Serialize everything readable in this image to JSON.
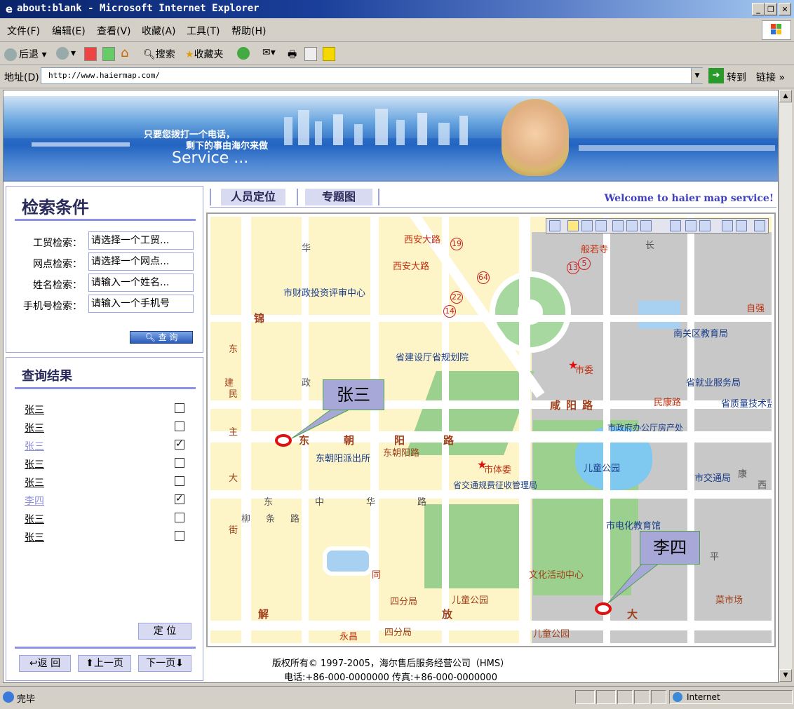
{
  "window": {
    "title": "about:blank - Microsoft Internet Explorer"
  },
  "menu": [
    "文件(F)",
    "编辑(E)",
    "查看(V)",
    "收藏(A)",
    "工具(T)",
    "帮助(H)"
  ],
  "toolbar": {
    "back": "后退",
    "search": "搜索",
    "favorites": "收藏夹"
  },
  "address": {
    "label": "地址(D)",
    "url": "http://www.haiermap.com/",
    "go": "转到",
    "links": "链接"
  },
  "banner": {
    "slogan1": "只要您拨打一个电话，",
    "slogan2": "剩下的事由海尔来做",
    "service": "Service ..."
  },
  "search": {
    "title": "检索条件",
    "fields": [
      {
        "label": "工贸检索：",
        "value": "请选择一个工贸..."
      },
      {
        "label": "网点检索：",
        "value": "请选择一个网点..."
      },
      {
        "label": "姓名检索：",
        "value": "请输入一个姓名..."
      },
      {
        "label": "手机号检索：",
        "value": "请输入一个手机号"
      }
    ],
    "query_button": "查 询"
  },
  "results": {
    "title": "查询结果",
    "items": [
      {
        "name": "张三",
        "checked": false
      },
      {
        "name": "张三",
        "checked": false
      },
      {
        "name": "张三",
        "checked": true
      },
      {
        "name": "张三",
        "checked": false
      },
      {
        "name": "张三",
        "checked": false
      },
      {
        "name": "李四",
        "checked": true
      },
      {
        "name": "张三",
        "checked": false
      },
      {
        "name": "张三",
        "checked": false
      }
    ],
    "locate_button": "定 位",
    "back_button": "返 回",
    "prev_button": "上一页",
    "next_button": "下一页"
  },
  "tabs": [
    "人员定位",
    "专题图"
  ],
  "welcome": "Welcome to haier map service!",
  "map": {
    "callouts": [
      "张三",
      "李四"
    ],
    "labels": {
      "xian_road1": "西安大路",
      "xian_road2": "西安大路",
      "caizheng": "市财政投资评审中心",
      "jianshe": "省建设厅省规划院",
      "chaoyang_pcs": "东朝阳派出所",
      "chaoyang_road": "东朝阳路",
      "tiwei": "市体委",
      "jiaotong_zhengshou": "省交通规费征收管理局",
      "wenhua": "文化活动中心",
      "sifenju1": "四分局",
      "sifenju2": "四分局",
      "ertong_gy1": "儿童公园",
      "ertong_gy2": "儿童公园",
      "yongchang": "永昌",
      "banruosi": "般若寺",
      "ziqiang": "自强",
      "nanguan_edu": "南关区教育局",
      "shiwei": "市委",
      "jiuye": "省就业服务局",
      "zhiliang": "省质量技术监",
      "minkang": "民康路",
      "bangongting": "市政府办公厅房产处",
      "ertong_park": "儿童公园",
      "jiaotong_ju": "市交通局",
      "dianhua_edu": "市电化教育馆",
      "caishichang": "菜市场",
      "xianyang_road": "咸阳路",
      "dong": "东",
      "chao": "朝",
      "yang": "阳",
      "lu": "路",
      "jin": "锦",
      "dong2": "东",
      "jian": "建",
      "min": "民",
      "zhu": "主",
      "da": "大",
      "jie": "街",
      "jie2": "解",
      "fang": "放",
      "da2": "大",
      "tong": "同",
      "hua": "华",
      "zheng": "政",
      "dongzhonghua": "东中华路",
      "liutiao": "柳条路",
      "xi": "西",
      "chang": "长",
      "ping": "平",
      "kang": "康"
    },
    "numbers": [
      "19",
      "64",
      "22",
      "14",
      "13",
      "5"
    ]
  },
  "footer": {
    "copyright": "版权所有© 1997-2005，海尔售后服务经营公司（HMS）",
    "contact": "电话:+86-000-0000000 传真:+86-000-0000000"
  },
  "status": {
    "text": "完毕",
    "zone": "Internet"
  },
  "colors": {
    "accent": "#9da3e0",
    "titlebar": "#0a246a",
    "callout": "#a8a8d8",
    "pin": "#e01010"
  }
}
